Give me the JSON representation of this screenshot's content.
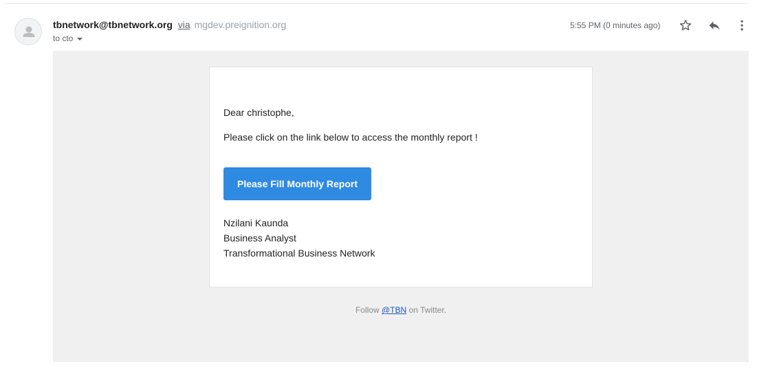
{
  "header": {
    "sender_email": "tbnetwork@tbnetwork.org",
    "via": "via",
    "via_domain": "mgdev.preignition.org",
    "recipient": "to cto",
    "timestamp": "5:55 PM (0 minutes ago)"
  },
  "email": {
    "greeting": "Dear christophe,",
    "message": "Please click on the link below to access the monthly report !",
    "cta_label": "Please Fill Monthly Report",
    "signature": {
      "name": "Nzilani Kaunda",
      "title": "Business Analyst",
      "organization": "Transformational Business Network"
    }
  },
  "footer": {
    "prefix": "Follow",
    "handle": "@TBN",
    "suffix": "on Twitter."
  },
  "icons": {
    "avatar": "person-icon",
    "star": "star-icon",
    "reply": "reply-icon",
    "more": "more-vert-icon"
  },
  "colors": {
    "cta": "#2f8ae1",
    "link": "#1a56c4",
    "body_background": "#f0f0f0"
  }
}
